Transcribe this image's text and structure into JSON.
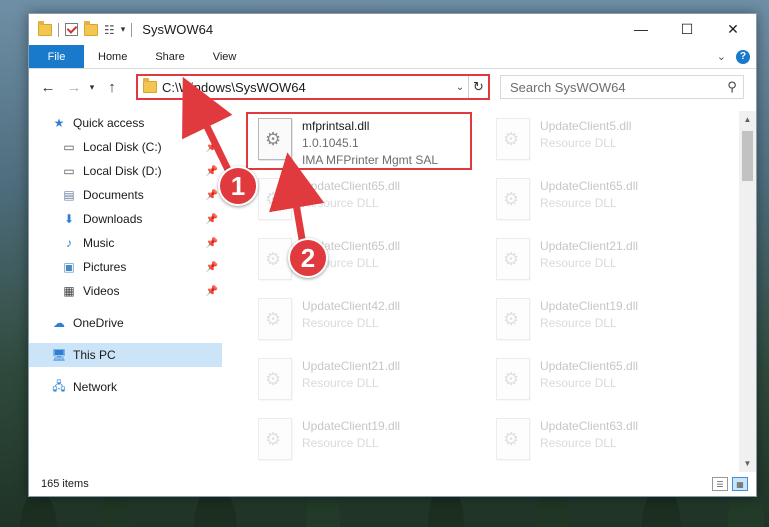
{
  "window": {
    "title": "SysWOW64",
    "controls": {
      "minimize": "—",
      "maximize": "☐",
      "close": "✕"
    }
  },
  "ribbon": {
    "tabs": [
      "File",
      "Home",
      "Share",
      "View"
    ]
  },
  "address_bar": {
    "path": "C:\\Windows\\SysWOW64",
    "search_placeholder": "Search SysWOW64"
  },
  "nav_pane": {
    "items": [
      {
        "label": "Quick access",
        "icon": "star-icon",
        "pinned": false
      },
      {
        "label": "Local Disk (C:)",
        "icon": "drive-icon",
        "pinned": true
      },
      {
        "label": "Local Disk (D:)",
        "icon": "drive-icon",
        "pinned": true
      },
      {
        "label": "Documents",
        "icon": "documents-icon",
        "pinned": true
      },
      {
        "label": "Downloads",
        "icon": "download-icon",
        "pinned": true
      },
      {
        "label": "Music",
        "icon": "music-icon",
        "pinned": true
      },
      {
        "label": "Pictures",
        "icon": "pictures-icon",
        "pinned": true
      },
      {
        "label": "Videos",
        "icon": "videos-icon",
        "pinned": true
      },
      {
        "label": "OneDrive",
        "icon": "cloud-icon",
        "pinned": false
      },
      {
        "label": "This PC",
        "icon": "computer-icon",
        "pinned": false,
        "selected": true
      },
      {
        "label": "Network",
        "icon": "network-icon",
        "pinned": false
      }
    ]
  },
  "files": [
    {
      "name": "mfprintsal.dll",
      "line2": "1.0.1045.1",
      "line3": "IMA MFPrinter Mgmt SAL",
      "highlighted": true
    },
    {
      "name": "UpdateClient5.dll",
      "line2": "Resource DLL"
    },
    {
      "name": "UpdateClient65.dll",
      "line2": "Resource DLL"
    },
    {
      "name": "UpdateClient65.dll",
      "line2": "Resource DLL"
    },
    {
      "name": "UpdateClient65.dll",
      "line2": "Resource DLL"
    },
    {
      "name": "UpdateClient21.dll",
      "line2": "Resource DLL"
    },
    {
      "name": "UpdateClient42.dll",
      "line2": "Resource DLL"
    },
    {
      "name": "UpdateClient19.dll",
      "line2": "Resource DLL"
    },
    {
      "name": "UpdateClient21.dll",
      "line2": "Resource DLL"
    },
    {
      "name": "UpdateClient65.dll",
      "line2": "Resource DLL"
    },
    {
      "name": "UpdateClient19.dll",
      "line2": "Resource DLL"
    },
    {
      "name": "UpdateClient63.dll",
      "line2": "Resource DLL"
    }
  ],
  "status_bar": {
    "item_count": "165 items"
  },
  "annotations": {
    "badge1": "1",
    "badge2": "2",
    "accent_color": "#e0393e"
  },
  "colors": {
    "file_tab": "#1979ca",
    "selection": "#cce4f7",
    "highlight_red": "#e0393e"
  }
}
